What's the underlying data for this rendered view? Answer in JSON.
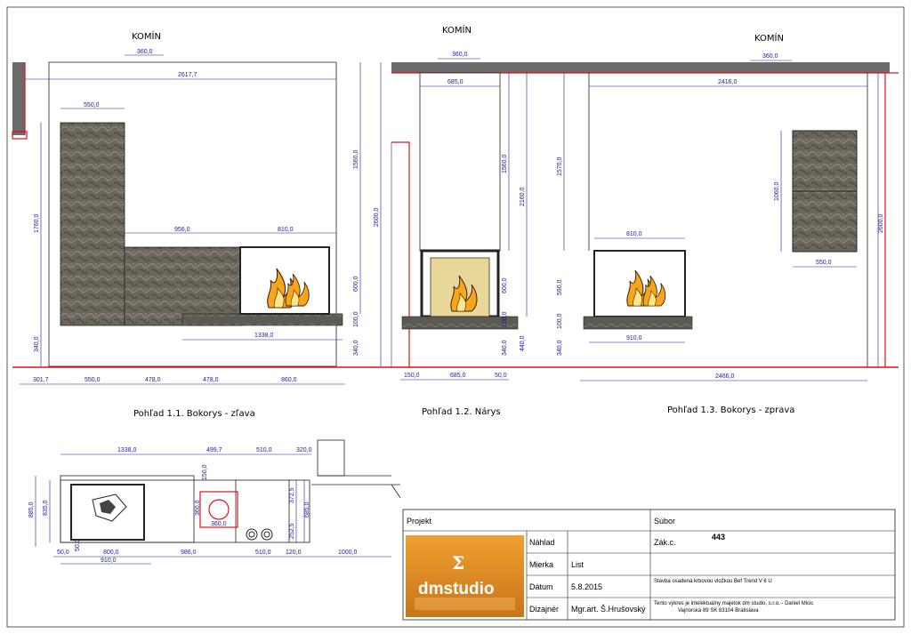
{
  "chimney_label": "KOMÍN",
  "views": [
    {
      "caption": "Pohľad 1.1. Bokorys - zľava"
    },
    {
      "caption": "Pohľad 1.2. Nárys"
    },
    {
      "caption": "Pohľad 1.3. Bokorys - zprava"
    }
  ],
  "dims": {
    "v1": {
      "chimney": "360,0",
      "top": "2617,7",
      "w550": "550,0",
      "h1760": "1760,0",
      "w956": "956,0",
      "w810": "810,0",
      "h1560": "1560,0",
      "h2600": "2600,0",
      "h600": "600,0",
      "h100": "100,0",
      "h340": "340,0",
      "w1338": "1338,0",
      "h340b": "340,0",
      "b1": "301,7",
      "b2": "550,0",
      "b3": "478,0",
      "b4": "478,0",
      "b5": "860,0"
    },
    "v2": {
      "chimney": "360,0",
      "top": "685,0",
      "h1560": "1560,0",
      "h2160": "2160,0",
      "h600": "600,0",
      "h100": "100,0",
      "h340": "340,0",
      "h440": "440,0",
      "b1": "150,0",
      "b2": "685,0",
      "b3": "50,0"
    },
    "v3": {
      "chimney": "360,0",
      "top": "2416,0",
      "h1570": "1570,0",
      "h1060": "1060,0",
      "h2600": "2600,0",
      "w810": "810,0",
      "h590": "590,0",
      "h100": "100,0",
      "h340": "340,0",
      "w910": "910,0",
      "w550": "550,0",
      "b1": "2466,0"
    },
    "plan": {
      "a": "1338,0",
      "b": "499,7",
      "c": "510,0",
      "d": "320,0",
      "e": "150,0",
      "f": "360,0",
      "g": "360,0",
      "h": "372,5",
      "i": "685,0",
      "j": "252,5",
      "k": "885,0",
      "l": "835,0",
      "m": "50,0",
      "n": "800,0",
      "o": "986,0",
      "p": "510,0",
      "q": "120,0",
      "r": "1000,0",
      "s": "910,0",
      "t": "50,0"
    }
  },
  "title_block": {
    "projekt_label": "Projekt",
    "subor_label": "Súbor",
    "nahlad_label": "Náhlad",
    "mierka_label": "Mierka",
    "mierka_value": "List",
    "datum_label": "Dátum",
    "datum_value": "5.8.2015",
    "dizajner_label": "Dizajnér",
    "dizajner_value": "Mgr.art. Š.Hrušovský",
    "zak_label": "Zák.c.",
    "zak_value": "443",
    "stavba": "Stavba osadená krbovou vložkou Bef Trend V 6 U",
    "copyright1": "Tento výkres je intelektuálny majetok dm studio, s.r.o. - Daniel Micic",
    "copyright2": "Vajnorská 89 SK 83104 Bratislava",
    "logo_text": "dmstudio"
  },
  "colors": {
    "accent": "#e0101a",
    "dim": "#1a1aa0",
    "logo_bg": "#e08a1a"
  }
}
